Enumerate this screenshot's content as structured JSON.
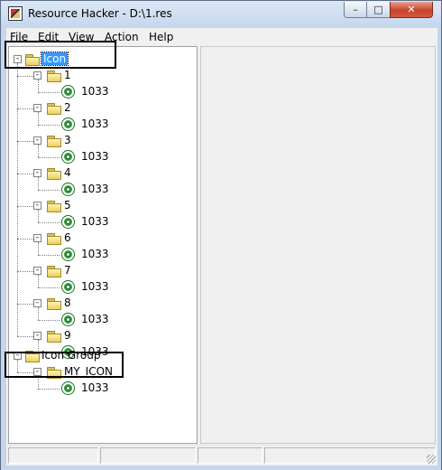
{
  "window": {
    "title": "Resource Hacker  -  D:\\1.res",
    "buttons": {
      "minimize": "–",
      "maximize": "□",
      "close": "✕"
    }
  },
  "menu": [
    "File",
    "Edit",
    "View",
    "Action",
    "Help"
  ],
  "tree": {
    "roots": [
      {
        "label": "Icon",
        "selected": true,
        "children": [
          {
            "label": "1",
            "leaf": "1033"
          },
          {
            "label": "2",
            "leaf": "1033"
          },
          {
            "label": "3",
            "leaf": "1033"
          },
          {
            "label": "4",
            "leaf": "1033"
          },
          {
            "label": "5",
            "leaf": "1033"
          },
          {
            "label": "6",
            "leaf": "1033"
          },
          {
            "label": "7",
            "leaf": "1033"
          },
          {
            "label": "8",
            "leaf": "1033"
          },
          {
            "label": "9",
            "leaf": "1033"
          }
        ]
      },
      {
        "label": "Icon Group",
        "selected": false,
        "children": [
          {
            "label": "MY_ICON",
            "leaf": "1033"
          }
        ]
      }
    ]
  },
  "icons": {
    "expander": "minus-box",
    "folder": "folder-icon",
    "resource": "gear-icon"
  },
  "colors": {
    "selection": "#3399ff",
    "titlebar": "#c5d6ec",
    "close_button": "#c7442a"
  }
}
